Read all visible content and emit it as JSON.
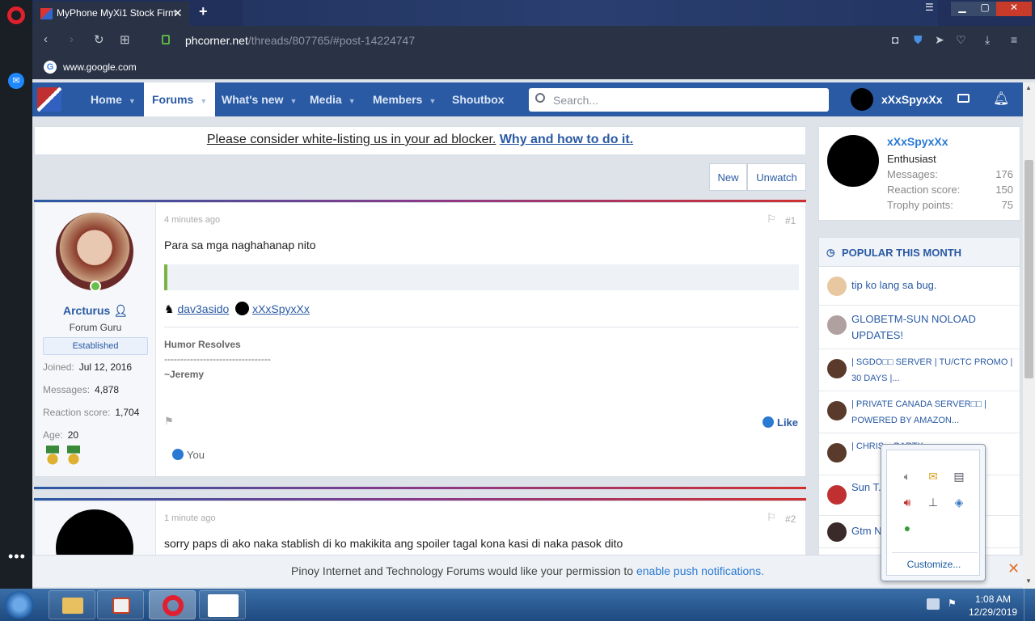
{
  "browser": {
    "tab_title": "MyPhone MyXi1 Stock Firm",
    "url_host": "phcorner.net",
    "url_path": "/threads/807765/#post-14224747",
    "bookmark": "www.google.com"
  },
  "site_nav": {
    "items": [
      "Home",
      "Forums",
      "What's new",
      "Media",
      "Members",
      "Shoutbox"
    ],
    "search_placeholder": "Search...",
    "username": "xXxSpyxXx"
  },
  "ad_notice": {
    "text": "Please consider white-listing us in your ad blocker.",
    "link": "Why and how to do it."
  },
  "thread_actions": {
    "new": "New",
    "unwatch": "Unwatch"
  },
  "post1": {
    "author": "Arcturus",
    "title": "Forum Guru",
    "badge": "Established",
    "joined_label": "Joined:",
    "joined": "Jul 12, 2016",
    "messages_label": "Messages:",
    "messages": "4,878",
    "reaction_label": "Reaction score:",
    "reaction": "1,704",
    "age_label": "Age:",
    "age": "20",
    "time": "4 minutes ago",
    "number": "#1",
    "body": "Para sa mga naghahanap nito",
    "reactor1": "dav3asido",
    "reactor2": "xXxSpyxXx",
    "sig_line1": "Humor Resolves",
    "sig_line2": "---------------------------------",
    "sig_line3": "~Jeremy",
    "like": "Like",
    "liked_by": "You"
  },
  "post2": {
    "time": "1 minute ago",
    "number": "#2",
    "body": "sorry paps di ako naka stablish di ko makikita ang spoiler tagal kona kasi di naka pasok dito"
  },
  "sidebar": {
    "username": "xXxSpyxXx",
    "rank": "Enthusiast",
    "messages_label": "Messages:",
    "messages": "176",
    "reaction_label": "Reaction score:",
    "reaction": "150",
    "trophy_label": "Trophy points:",
    "trophy": "75",
    "popular_title": "POPULAR THIS MONTH",
    "popular": [
      "tip ko lang sa bug.",
      "GLOBETM-SUN NOLOAD UPDATES!",
      "| SGDO□□ SERVER | TU/CTC PROMO | 30 DAYS |...",
      "| PRIVATE CANADA SERVER□□ | POWERED BY AMAZON...",
      "| CHRIS... BARTX...",
      "Sun T... EHIL[4...",
      "Gtm N..."
    ]
  },
  "push_notice": {
    "text": "Pinoy Internet and Technology Forums would like your permission to",
    "link": "enable push notifications."
  },
  "tray": {
    "customize": "Customize..."
  },
  "clock": {
    "time": "1:08 AM",
    "date": "12/29/2019"
  }
}
